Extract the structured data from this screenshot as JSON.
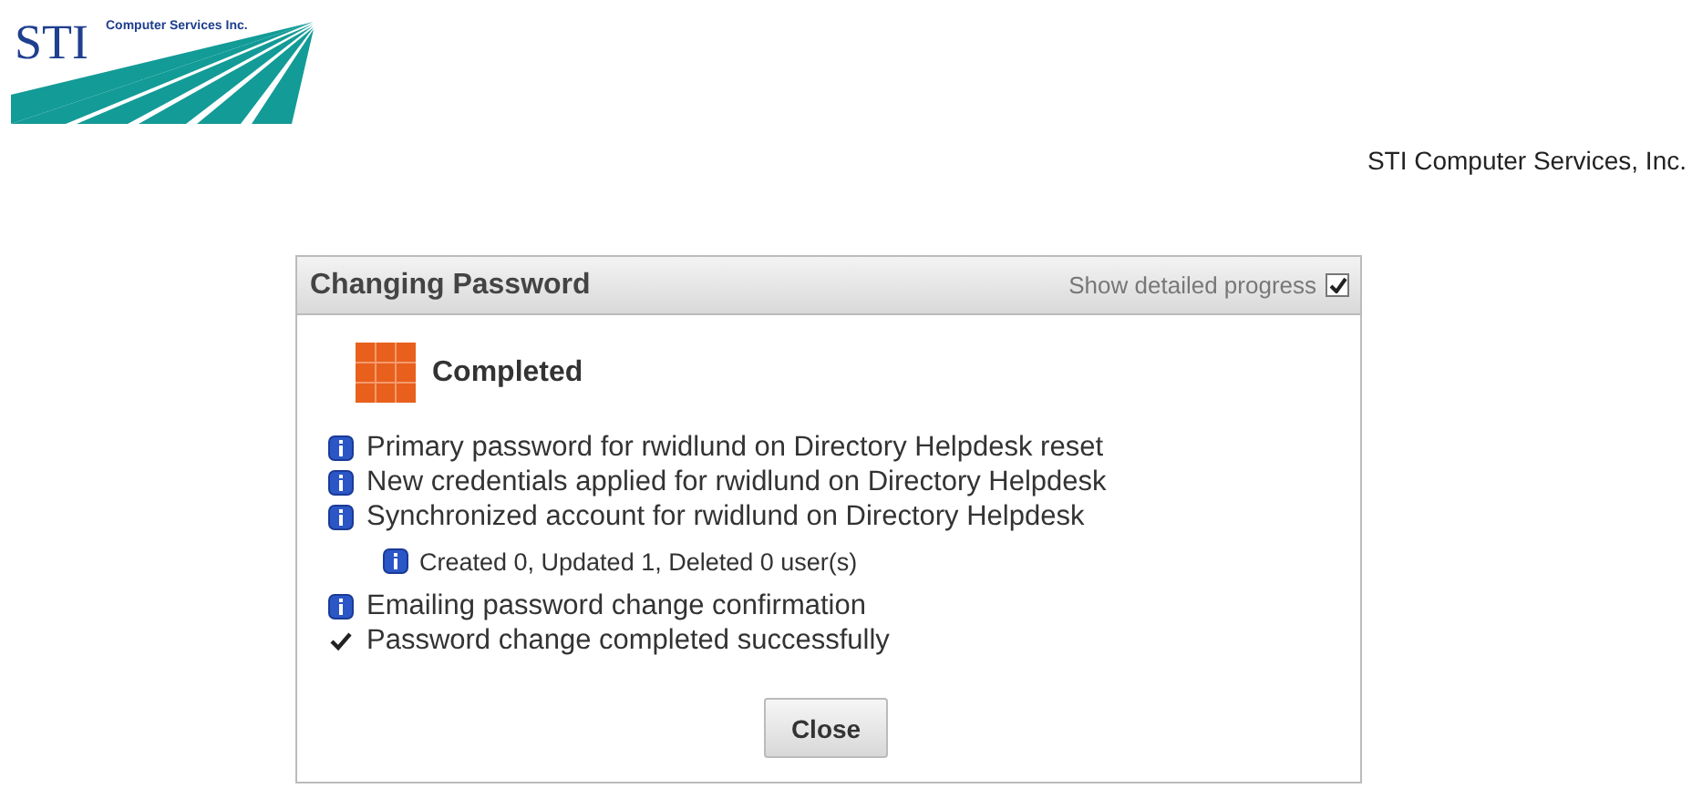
{
  "logo": {
    "mark": "STI",
    "tagline": "Computer Services Inc."
  },
  "company": "STI Computer Services, Inc.",
  "dialog": {
    "title": "Changing Password",
    "show_detailed_progress": {
      "label": "Show detailed progress",
      "checked": true
    },
    "status": "Completed",
    "log": [
      {
        "kind": "info",
        "text": "Primary password for rwidlund on Directory Helpdesk reset"
      },
      {
        "kind": "info",
        "text": "New credentials applied for rwidlund on Directory Helpdesk"
      },
      {
        "kind": "info",
        "text": "Synchronized account for rwidlund on Directory Helpdesk",
        "children": [
          {
            "kind": "info",
            "text": "Created 0, Updated 1, Deleted 0 user(s)"
          }
        ]
      },
      {
        "kind": "info",
        "text": "Emailing password change confirmation"
      },
      {
        "kind": "success",
        "text": "Password change completed successfully"
      }
    ],
    "buttons": [
      "Close"
    ]
  }
}
